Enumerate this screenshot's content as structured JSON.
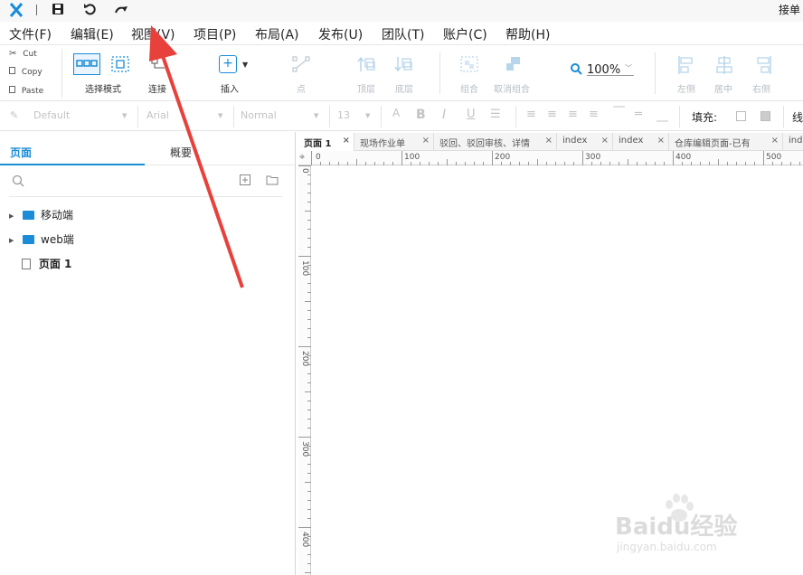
{
  "app": {
    "logo": "x-logo",
    "top_right_text": "接单"
  },
  "menu": [
    "文件(F)",
    "编辑(E)",
    "视图(V)",
    "项目(P)",
    "布局(A)",
    "发布(U)",
    "团队(T)",
    "账户(C)",
    "帮助(H)"
  ],
  "clipboard": {
    "cut": "Cut",
    "copy": "Copy",
    "paste": "Paste"
  },
  "toolbar": {
    "select_mode": "选择模式",
    "connect": "连接",
    "insert": "插入",
    "point": "点",
    "top_layer": "顶层",
    "bottom_layer": "底层",
    "group": "组合",
    "ungroup": "取消组合",
    "zoom": "100%",
    "align_left": "左侧",
    "align_center": "居中",
    "align_right": "右侧"
  },
  "format": {
    "style": "Default",
    "font": "Arial",
    "weight": "Normal",
    "size": "13",
    "fill_label": "填充:",
    "line_label": "线"
  },
  "left_panel": {
    "tab_pages": "页面",
    "tab_outline": "概要",
    "tree": [
      {
        "type": "folder",
        "label": "移动端"
      },
      {
        "type": "folder",
        "label": "web端"
      },
      {
        "type": "page",
        "label": "页面 1"
      }
    ]
  },
  "doc_tabs": [
    "页面 1",
    "现场作业单",
    "驳回、驳回审核、详情",
    "index",
    "index",
    "仓库编辑页面-已有",
    "inde"
  ],
  "ruler_h": [
    "0",
    "100",
    "200",
    "300",
    "400",
    "500"
  ],
  "ruler_v": [
    "0",
    "100",
    "200",
    "300",
    "400"
  ],
  "watermark": {
    "brand": "Baidu经验",
    "url": "jingyan.baidu.com"
  },
  "colors": {
    "accent": "#1a8cd8",
    "arrow": "#e8413c",
    "folder": "#1a8cd8"
  }
}
